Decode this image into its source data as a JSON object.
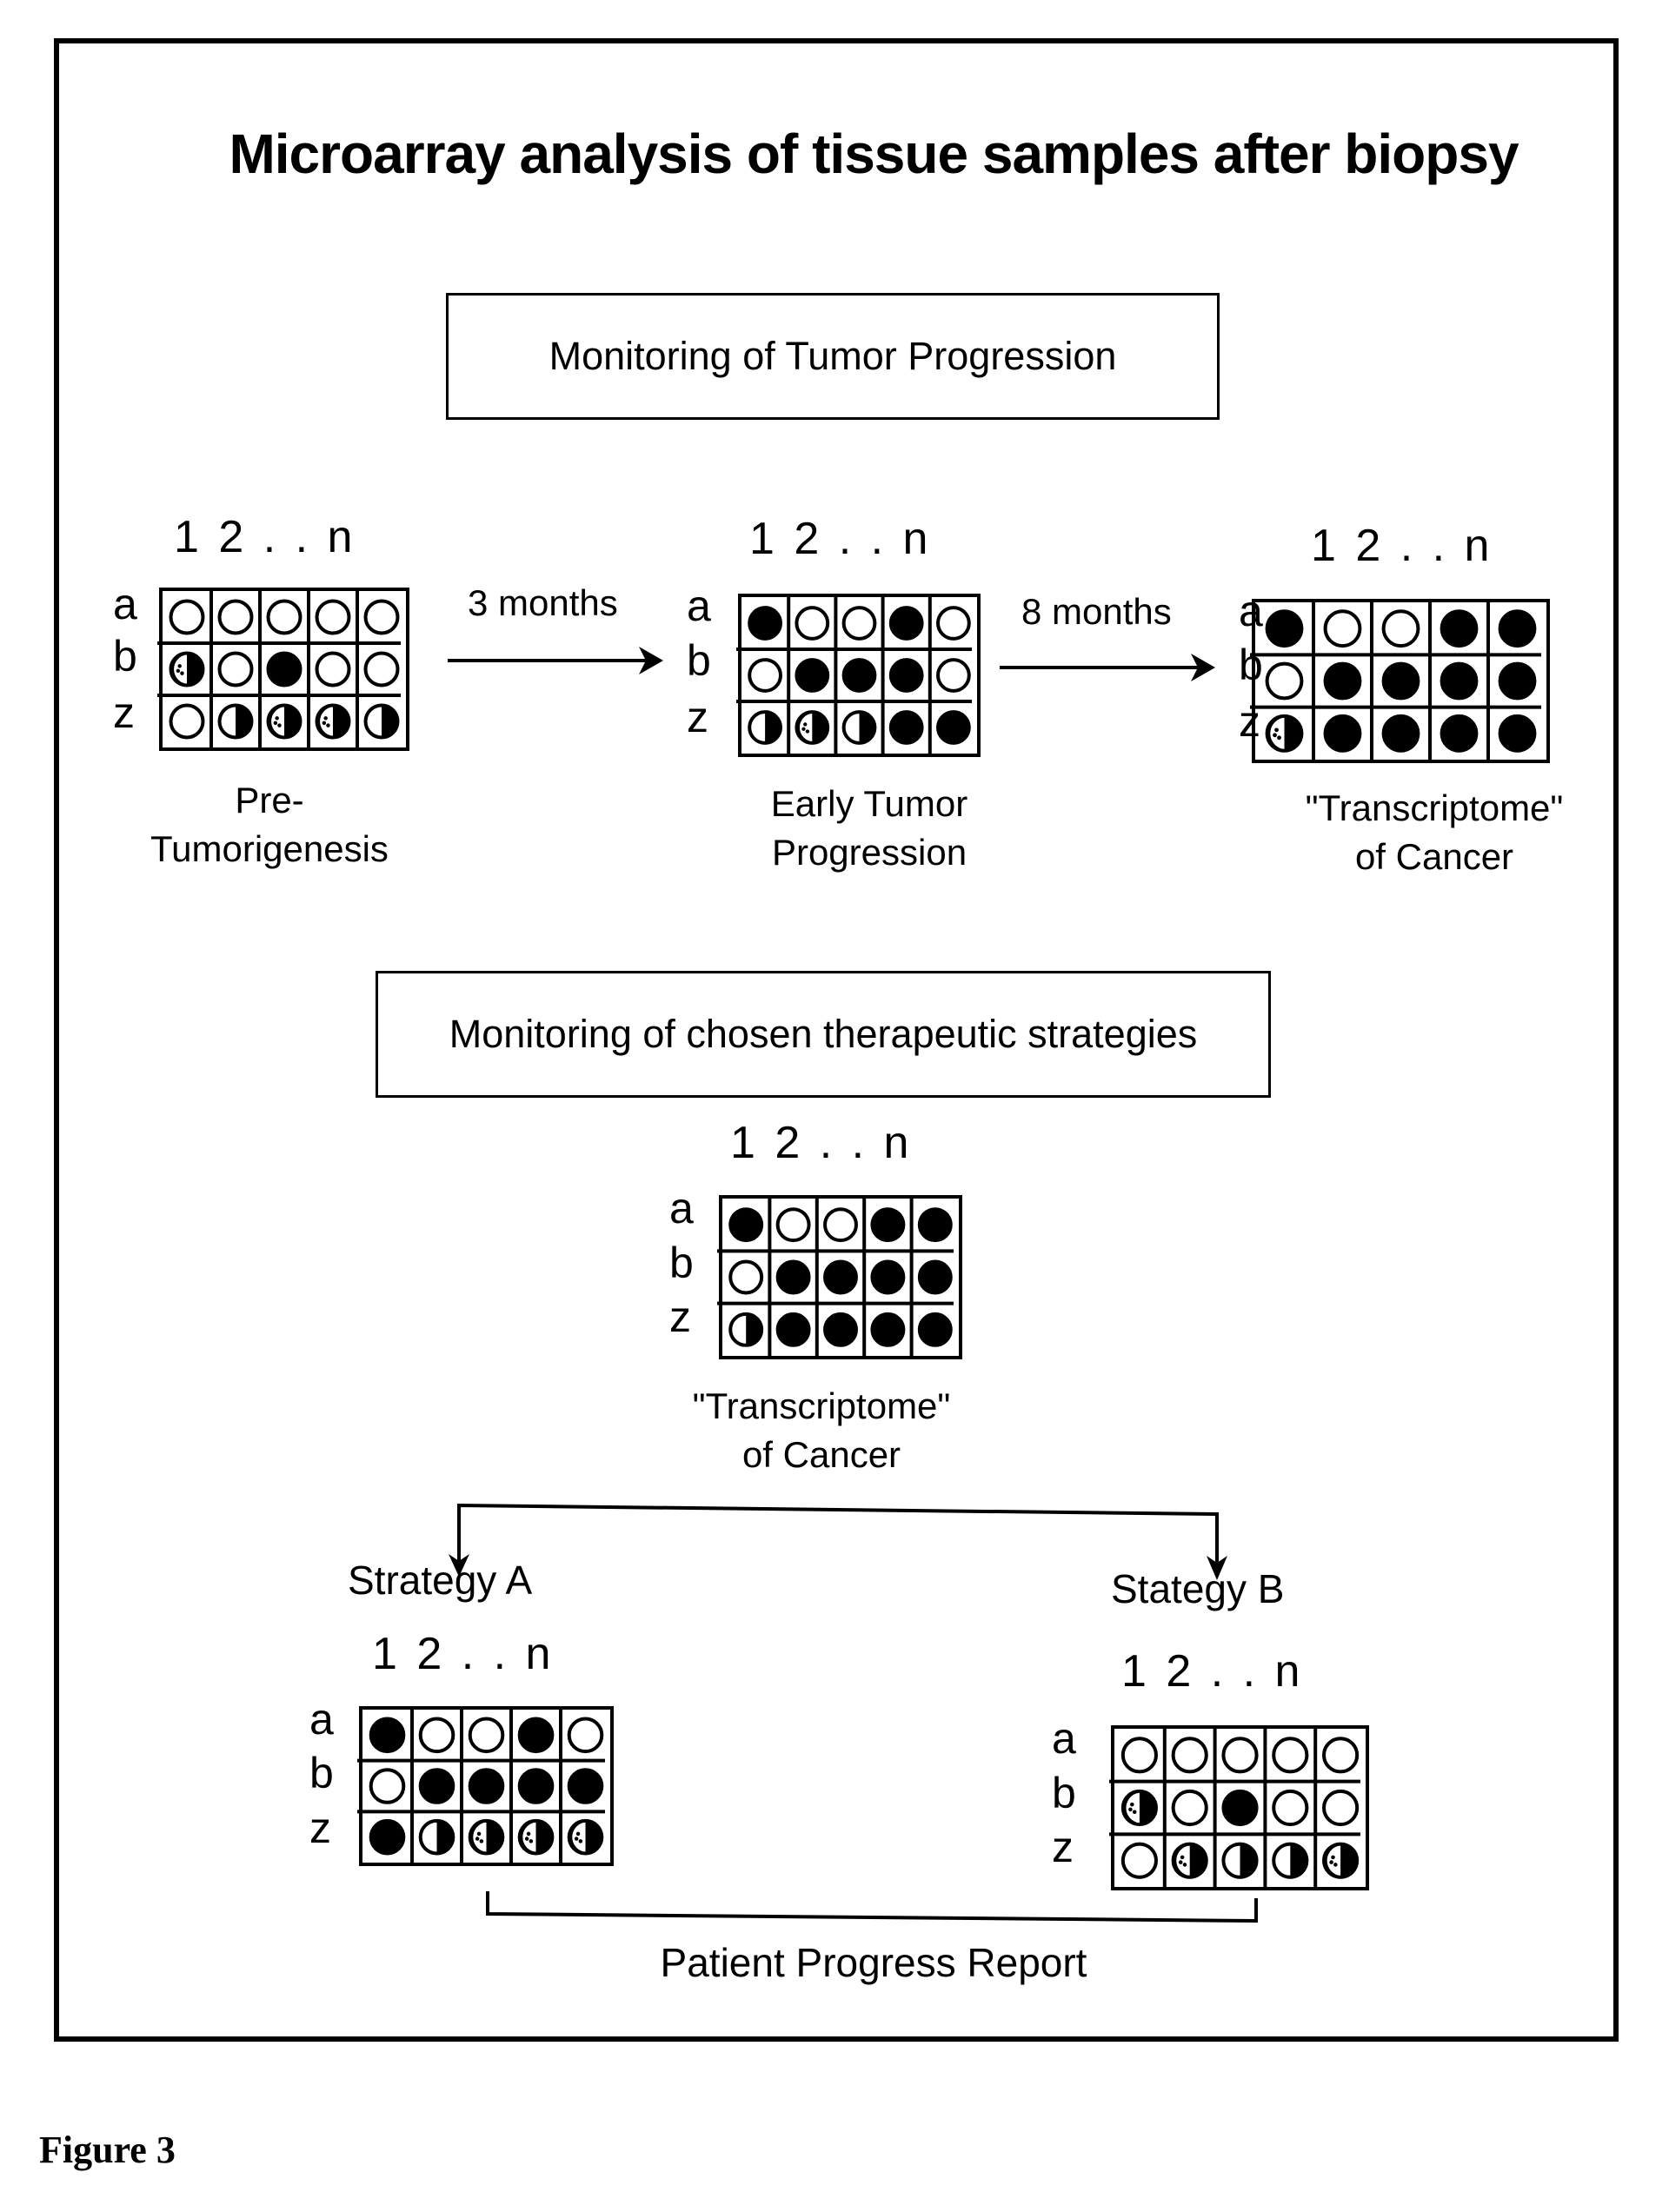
{
  "title": "Microarray analysis of tissue samples after biopsy",
  "figure_label": "Figure 3",
  "sections": {
    "tumor_progression": "Monitoring of Tumor Progression",
    "therapeutic": "Monitoring of chosen therapeutic strategies"
  },
  "column_header": "1 2 . . n",
  "row_labels": [
    "a",
    "b",
    "z"
  ],
  "arrows": {
    "first": "3 months",
    "second": "8 months"
  },
  "legend_states": {
    "O": "empty circle (not expressed)",
    "F": "filled circle (expressed)",
    "H": "half-filled circle",
    "P": "partially filled circle"
  },
  "grids": [
    {
      "id": "pre-tumorigenesis",
      "caption": [
        "Pre-",
        "Tumorigenesis"
      ],
      "rows": [
        [
          "O",
          "O",
          "O",
          "O",
          "O"
        ],
        [
          "P",
          "O",
          "F",
          "O",
          "O"
        ],
        [
          "O",
          "H",
          "P",
          "P",
          "H"
        ]
      ]
    },
    {
      "id": "early-tumor-progression",
      "caption": [
        "Early Tumor",
        "Progression"
      ],
      "rows": [
        [
          "F",
          "O",
          "O",
          "F",
          "O"
        ],
        [
          "O",
          "F",
          "F",
          "F",
          "O"
        ],
        [
          "H",
          "P",
          "H",
          "F",
          "F"
        ]
      ]
    },
    {
      "id": "transcriptome-top",
      "caption": [
        "\"Transcriptome\"",
        "of Cancer"
      ],
      "rows": [
        [
          "F",
          "O",
          "O",
          "F",
          "F"
        ],
        [
          "O",
          "F",
          "F",
          "F",
          "F"
        ],
        [
          "P",
          "F",
          "F",
          "F",
          "F"
        ]
      ]
    },
    {
      "id": "transcriptome-middle",
      "caption": [
        "\"Transcriptome\"",
        "of Cancer"
      ],
      "rows": [
        [
          "F",
          "O",
          "O",
          "F",
          "F"
        ],
        [
          "O",
          "F",
          "F",
          "F",
          "F"
        ],
        [
          "H",
          "F",
          "F",
          "F",
          "F"
        ]
      ]
    },
    {
      "id": "strategy-a",
      "caption": [
        "Strategy A"
      ],
      "rows": [
        [
          "F",
          "O",
          "O",
          "F",
          "O"
        ],
        [
          "O",
          "F",
          "F",
          "F",
          "F"
        ],
        [
          "F",
          "H",
          "P",
          "P",
          "P"
        ]
      ]
    },
    {
      "id": "strategy-b",
      "caption": [
        "Stategy B"
      ],
      "rows": [
        [
          "O",
          "O",
          "O",
          "O",
          "O"
        ],
        [
          "P",
          "O",
          "F",
          "O",
          "O"
        ],
        [
          "O",
          "P",
          "H",
          "H",
          "P"
        ]
      ]
    }
  ],
  "bottom_label": "Patient Progress Report"
}
